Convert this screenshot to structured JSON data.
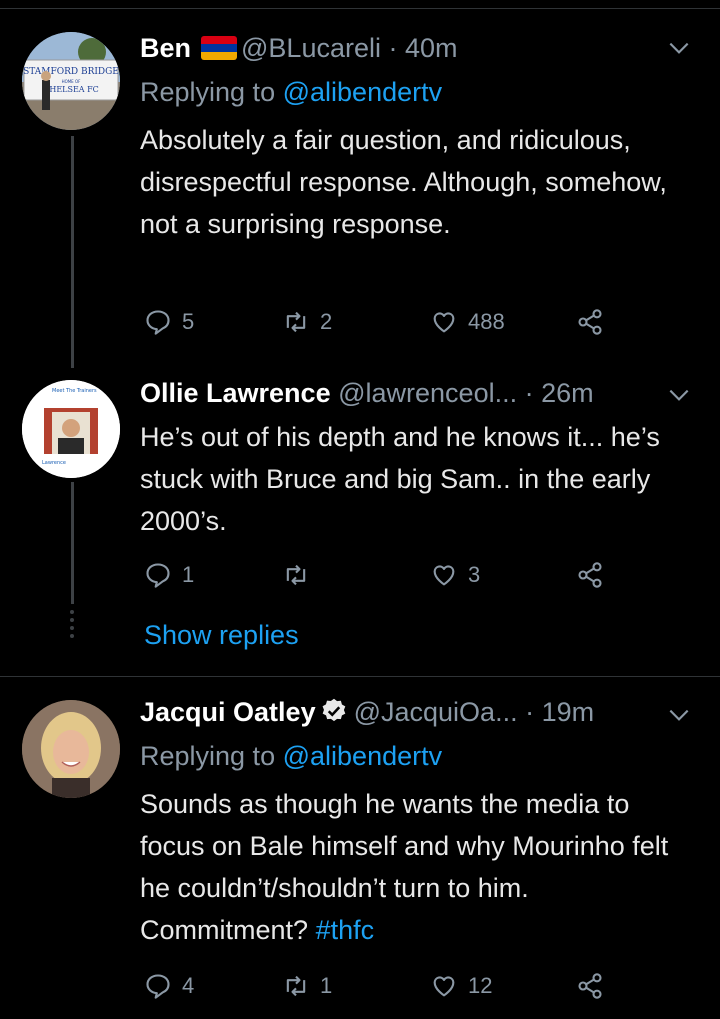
{
  "tweets": [
    {
      "name": "Ben",
      "handle": "@BLucareli",
      "time": "· 40m",
      "replying_label": "Replying to",
      "replying_handle": "@alibendertv",
      "text": "Absolutely a fair question, and ridiculous, disrespectful response. Although, somehow, not a surprising response.",
      "replies": "5",
      "retweets": "2",
      "likes": "488",
      "avatar_sign_lines": [
        "STAMFORD BRIDGE",
        "HOME OF",
        "CHELSEA FC"
      ]
    },
    {
      "name": "Ollie Lawrence",
      "handle": "@lawrenceol...",
      "time": "· 26m",
      "text": "He’s out of his depth and he knows it... he’s stuck with Bruce and big Sam.. in the early 2000’s.",
      "replies": "1",
      "retweets": "",
      "likes": "3",
      "show_replies": "Show replies",
      "avatar_text": [
        "Meet The Trainers",
        "Lawrence"
      ]
    },
    {
      "name": "Jacqui Oatley",
      "handle": "@JacquiOa...",
      "time": "· 19m",
      "replying_label": "Replying to",
      "replying_handle": "@alibendertv",
      "text_main": "Sounds as though he wants the media to focus on Bale himself and why Mourinho felt he couldn’t/shouldn’t turn to him. Commitment?",
      "hashtag": "#thfc",
      "replies": "4",
      "retweets": "1",
      "likes": "12"
    }
  ],
  "colors": {
    "background": "#000000",
    "link": "#1da1f2",
    "muted": "#8b98a5",
    "flag": [
      "#d90012",
      "#0033a0",
      "#f2a800"
    ]
  },
  "icons": [
    "reply-icon",
    "retweet-icon",
    "like-icon",
    "share-icon",
    "chevron-down-icon",
    "verified-icon",
    "armenia-flag-icon"
  ]
}
